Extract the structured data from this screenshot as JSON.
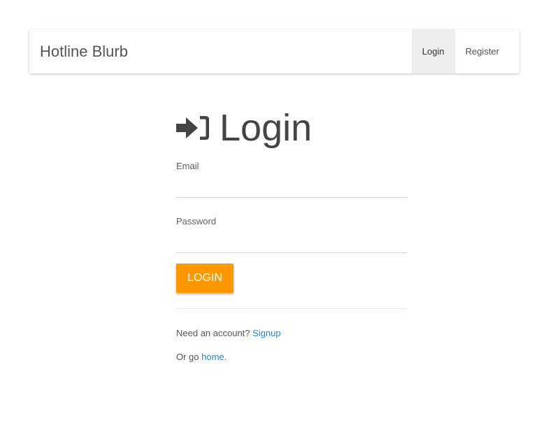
{
  "navbar": {
    "brand": "Hotline Blurb",
    "links": [
      {
        "label": "Login",
        "active": true
      },
      {
        "label": "Register",
        "active": false
      }
    ]
  },
  "login": {
    "title": "Login",
    "icon": "sign-in-icon",
    "email": {
      "label": "Email",
      "value": ""
    },
    "password": {
      "label": "Password",
      "value": ""
    },
    "button_label": "LOGIN"
  },
  "footer": {
    "signup_prefix": "Need an account? ",
    "signup_link": "Signup",
    "home_prefix": "Or go ",
    "home_link": "home",
    "home_suffix": "."
  },
  "colors": {
    "accent": "#ff9800",
    "link": "#2e86c1",
    "active_nav_bg": "#eeeeee"
  }
}
